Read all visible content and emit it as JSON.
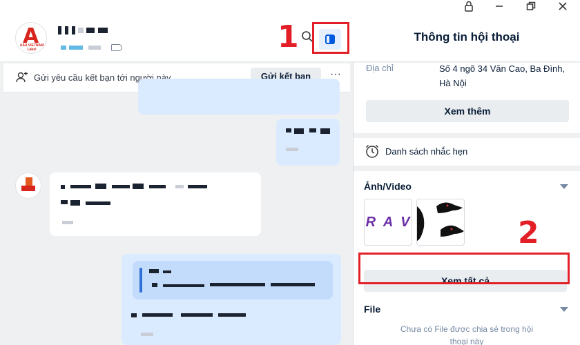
{
  "window": {
    "lock_glyph": "🔒",
    "restore_glyph": "❐",
    "minimize_glyph": "—",
    "close_glyph": "✕"
  },
  "chat_header": {
    "avatar": {
      "letter": "A",
      "caption": "AAA VIETNAM Label"
    },
    "search_icon": "search-icon",
    "toggle_info_icon": "layout-panel-icon"
  },
  "friend_bar": {
    "text": "Gửi yêu cầu kết bạn tới người này",
    "button": "Gửi kết bạn",
    "more": "···"
  },
  "annotations": {
    "marker_1": "1",
    "marker_2": "2",
    "color": "#e21f26"
  },
  "info_panel": {
    "title": "Thông tin hội thoại",
    "address_label": "Địa chỉ",
    "address_value": "Số 4 ngõ 34 Văn Cao, Ba Đình, Hà Nội",
    "see_more": "Xem thêm",
    "reminders": "Danh sách nhắc hẹn",
    "media_title": "Ảnh/Video",
    "media_thumb_1_text": "R A V",
    "see_all": "Xem tất cả",
    "file_title": "File",
    "file_empty": "Chưa có File được chia sẻ trong hội thoại này"
  },
  "colors": {
    "accent": "#005ae0",
    "my_bubble": "#dbebff",
    "background": "#eef0f1"
  }
}
